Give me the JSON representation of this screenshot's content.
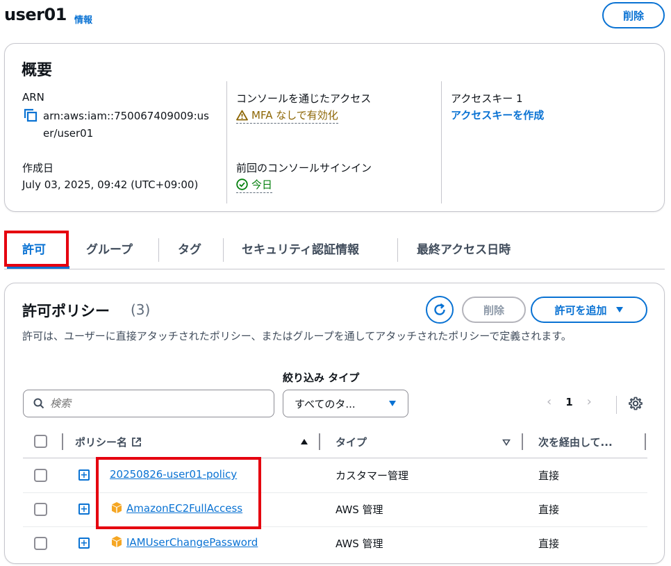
{
  "header": {
    "title": "user01",
    "info_link": "情報",
    "delete_label": "削除"
  },
  "summary": {
    "title": "概要",
    "arn_label": "ARN",
    "arn_line1": "arn:aws:iam::750067409009:us",
    "arn_line2": "er/user01",
    "created_label": "作成日",
    "created_value": "July 03, 2025, 09:42 (UTC+09:00)",
    "console_access_label": "コンソールを通じたアクセス",
    "console_access_value": "MFA なしで有効化",
    "last_signin_label": "前回のコンソールサインイン",
    "last_signin_value": "今日",
    "access_key_label": "アクセスキー 1",
    "access_key_link": "アクセスキーを作成"
  },
  "tabs": [
    {
      "label": "許可"
    },
    {
      "label": "グループ"
    },
    {
      "label": "タグ"
    },
    {
      "label": "セキュリティ認証情報"
    },
    {
      "label": "最終アクセス日時"
    }
  ],
  "policies": {
    "title": "許可ポリシー",
    "count": "(3)",
    "delete_label": "削除",
    "add_label": "許可を追加",
    "description": "許可は、ユーザーに直接アタッチされたポリシー、またはグループを通してアタッチされたポリシーで定義されます。",
    "filter_label": "絞り込み タイプ",
    "search_placeholder": "検索",
    "type_select": "すべてのタ...",
    "page": "1",
    "columns": {
      "name": "ポリシー名",
      "type": "タイプ",
      "via": "次を経由して..."
    },
    "rows": [
      {
        "name": "20250826-user01-policy",
        "type": "カスタマー管理",
        "via": "直接"
      },
      {
        "name": "AmazonEC2FullAccess",
        "type": "AWS 管理",
        "via": "直接"
      },
      {
        "name": "IAMUserChangePassword",
        "type": "AWS 管理",
        "via": "直接"
      }
    ]
  },
  "colors": {
    "link_blue": "#0972d3",
    "warning": "#8d6605",
    "success": "#037f0c",
    "highlight_red": "#e5000f"
  }
}
